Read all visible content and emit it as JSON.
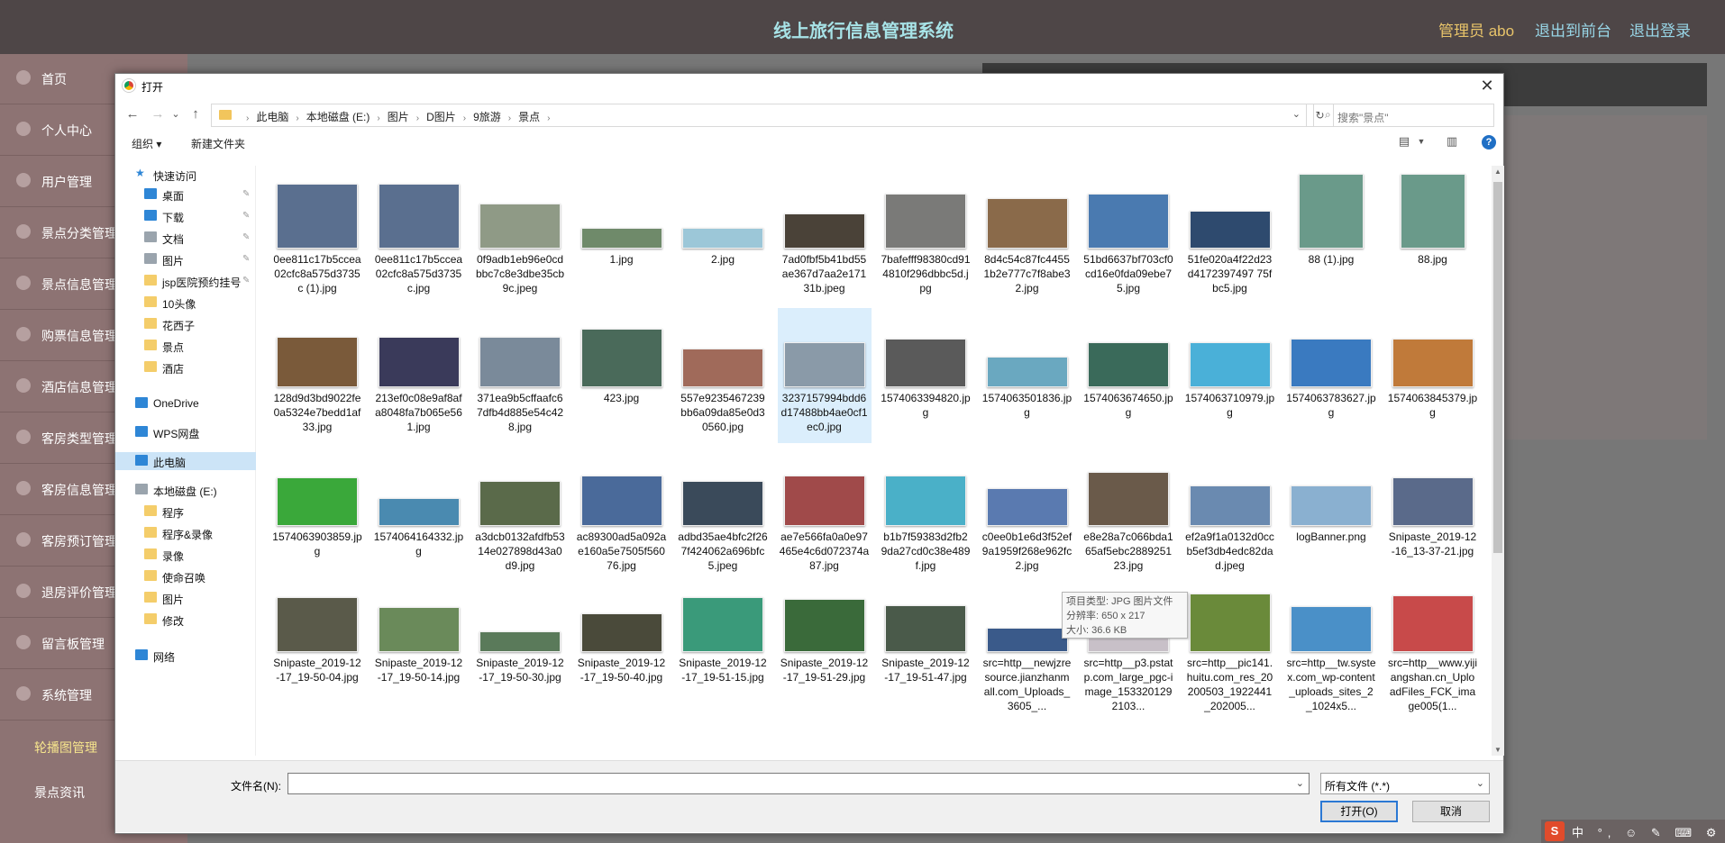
{
  "app": {
    "title": "线上旅行信息管理系统",
    "admin": "管理员 abo",
    "links": [
      "退出到前台",
      "退出登录"
    ]
  },
  "sidebar": {
    "items": [
      "首页",
      "个人中心",
      "用户管理",
      "景点分类管理",
      "景点信息管理",
      "购票信息管理",
      "酒店信息管理",
      "客房类型管理",
      "客房信息管理",
      "客房预订管理",
      "退房评价管理",
      "留言板管理",
      "系统管理"
    ],
    "subs": [
      "轮播图管理",
      "景点资讯"
    ]
  },
  "dialog": {
    "title": "打开",
    "nav": {
      "back": "←",
      "forward": "→",
      "recent": "⌄",
      "up": "↑",
      "refresh": "↻"
    },
    "breadcrumb": [
      "此电脑",
      "本地磁盘 (E:)",
      "图片",
      "D图片",
      "9旅游",
      "景点"
    ],
    "search_placeholder": "搜索\"景点\"",
    "toolbar": {
      "organize": "组织 ▾",
      "new_folder": "新建文件夹",
      "help": "?"
    },
    "nav_pane": {
      "quick_access": "快速访问",
      "pinned": [
        "桌面",
        "下载",
        "文档",
        "图片",
        "jsp医院预约挂号"
      ],
      "folders": [
        "10头像",
        "花西子",
        "景点",
        "酒店"
      ],
      "onedrive": "OneDrive",
      "wps": "WPS网盘",
      "this_pc": "此电脑",
      "disk": "本地磁盘 (E:)",
      "disk_folders": [
        "程序",
        "程序&录像",
        "录像",
        "使命召唤",
        "图片",
        "修改"
      ],
      "network": "网络"
    },
    "files": [
      {
        "name": "0ee811c17b5ccea02cfc8a575d3735c (1).jpg",
        "color": "#5a6f8f"
      },
      {
        "name": "0ee811c17b5ccea02cfc8a575d3735c.jpg",
        "color": "#5a6f8f"
      },
      {
        "name": "0f9adb1eb96e0cdbbc7c8e3dbe35cb9c.jpeg",
        "color": "#8f9a86"
      },
      {
        "name": "1.jpg",
        "color": "#6f8a6a"
      },
      {
        "name": "2.jpg",
        "color": "#9cc7d8"
      },
      {
        "name": "7ad0fbf5b41bd55ae367d7aa2e17131b.jpeg",
        "color": "#4a4238"
      },
      {
        "name": "7bafefff98380cd914810f296dbbc5d.jpg",
        "color": "#7a7a78"
      },
      {
        "name": "8d4c54c87fc44551b2e777c7f8abe32.jpg",
        "color": "#8a6a4a"
      },
      {
        "name": "51bd6637bf703cf0cd16e0fda09ebe75.jpg",
        "color": "#4a7ab0"
      },
      {
        "name": "51fe020a4f22d23d4172397497 75fbc5.jpg",
        "color": "#2e4a6e"
      },
      {
        "name": "88 (1).jpg",
        "color": "#6a9a8a"
      },
      {
        "name": "88.jpg",
        "color": "#6a9a8a"
      },
      {
        "name": "128d9d3bd9022fe0a5324e7bedd1af33.jpg",
        "color": "#7a5a3a"
      },
      {
        "name": "213ef0c08e9af8afa8048fa7b065e561.jpg",
        "color": "#3a3a5a"
      },
      {
        "name": "371ea9b5cffaafc67dfb4d885e54c428.jpg",
        "color": "#7a8a9a"
      },
      {
        "name": "423.jpg",
        "color": "#4a6a5a"
      },
      {
        "name": "557e9235467239bb6a09da85e0d30560.jpg",
        "color": "#a06a5a"
      },
      {
        "name": "3237157994bdd6d17488bb4ae0cf1ec0.jpg",
        "color": "#8a9aa8"
      },
      {
        "name": "1574063394820.jpg",
        "color": "#5a5a5a"
      },
      {
        "name": "1574063501836.jpg",
        "color": "#6aa8c0"
      },
      {
        "name": "1574063674650.jpg",
        "color": "#3a6a5a"
      },
      {
        "name": "1574063710979.jpg",
        "color": "#4ab0d8"
      },
      {
        "name": "1574063783627.jpg",
        "color": "#3a7ac0"
      },
      {
        "name": "1574063845379.jpg",
        "color": "#c07a3a"
      },
      {
        "name": "1574063903859.jpg",
        "color": "#3aa83a"
      },
      {
        "name": "1574064164332.jpg",
        "color": "#4a8ab0"
      },
      {
        "name": "a3dcb0132afdfb5314e027898d43a0d9.jpg",
        "color": "#5a6a4a"
      },
      {
        "name": "ac89300ad5a092ae160a5e7505f56076.jpg",
        "color": "#4a6a9a"
      },
      {
        "name": "adbd35ae4bfc2f267f424062a696bfc5.jpeg",
        "color": "#3a4a5a"
      },
      {
        "name": "ae7e566fa0a0e97465e4c6d072374a87.jpg",
        "color": "#a04a4a"
      },
      {
        "name": "b1b7f59383d2fb29da27cd0c38e489f.jpg",
        "color": "#4ab0c8"
      },
      {
        "name": "c0ee0b1e6d3f52ef9a1959f268e962fc2.jpg",
        "color": "#5a7ab0"
      },
      {
        "name": "e8e28a7c066bda165af5ebc288925123.jpg",
        "color": "#6a5a4a"
      },
      {
        "name": "ef2a9f1a0132d0ccb5ef3db4edc82dad.jpeg",
        "color": "#6a8ab0"
      },
      {
        "name": "logBanner.png",
        "color": "#8ab0d0"
      },
      {
        "name": "Snipaste_2019-12-16_13-37-21.jpg",
        "color": "#5a6a8a"
      },
      {
        "name": "Snipaste_2019-12-17_19-50-04.jpg",
        "color": "#5a5a4a"
      },
      {
        "name": "Snipaste_2019-12-17_19-50-14.jpg",
        "color": "#6a8a5a"
      },
      {
        "name": "Snipaste_2019-12-17_19-50-30.jpg",
        "color": "#5a7a5a"
      },
      {
        "name": "Snipaste_2019-12-17_19-50-40.jpg",
        "color": "#4a4a3a"
      },
      {
        "name": "Snipaste_2019-12-17_19-51-15.jpg",
        "color": "#3a9a7a"
      },
      {
        "name": "Snipaste_2019-12-17_19-51-29.jpg",
        "color": "#3a6a3a"
      },
      {
        "name": "Snipaste_2019-12-17_19-51-47.jpg",
        "color": "#4a5a4a"
      },
      {
        "name": "src=http__newjzresource.jianzhanmall.com_Uploads_3605_...",
        "color": "#3a5a8a"
      },
      {
        "name": "src=http__p3.pstatp.com_large_pgc-image_1533201292103...",
        "color": "#c8c0c8"
      },
      {
        "name": "src=http__pic141.huitu.com_res_20200503_1922441_202005...",
        "color": "#6a8a3a"
      },
      {
        "name": "src=http__tw.systex.com_wp-content_uploads_sites_2_1024x5...",
        "color": "#4a90c8"
      },
      {
        "name": "src=http__www.yijiangshan.cn_UploadFiles_FCK_image005(1...",
        "color": "#c84a4a"
      }
    ],
    "tooltip": {
      "type": "项目类型: JPG 图片文件",
      "res": "分辨率: 650 x 217",
      "size": "大小: 36.6 KB"
    },
    "filename_label": "文件名(N):",
    "filetype": "所有文件 (*.*)",
    "open": "打开(O)",
    "cancel": "取消",
    "close": "✕"
  },
  "tray": {
    "ime": "中 °, ☺ ✎ ⌨ ⚙"
  }
}
